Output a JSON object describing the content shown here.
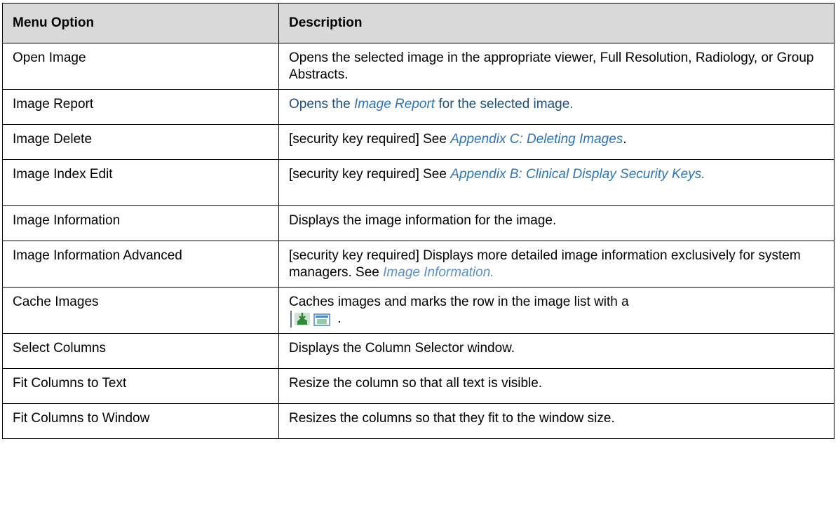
{
  "table": {
    "headers": {
      "menu_option": "Menu Option",
      "description": "Description"
    },
    "rows": [
      {
        "option": "Open Image",
        "desc": "Opens the selected image in the appropriate viewer, Full Resolution, Radiology, or Group Abstracts."
      },
      {
        "option": "Image Report",
        "desc_pre": "Opens the ",
        "desc_link": "Image Report",
        "desc_post": " for the selected image."
      },
      {
        "option": "Image Delete",
        "desc_pre": "[security key required] See ",
        "desc_link": "Appendix C: Deleting Images",
        "desc_post": "."
      },
      {
        "option": "Image Index Edit",
        "desc_pre": "[security key required] See ",
        "desc_link": "Appendix B: Clinical Display Security Keys."
      },
      {
        "option": "Image Information",
        "desc": "Displays the image information for the image."
      },
      {
        "option": "Image Information Advanced",
        "desc_pre": "[security key required] Displays more detailed image information exclusively for system managers. See ",
        "desc_link": "Image Information."
      },
      {
        "option": "Cache Images",
        "desc_pre": "Caches images and marks the row in the image list with a",
        "desc_post": " ."
      },
      {
        "option": "Select Columns",
        "desc": "Displays the Column Selector window."
      },
      {
        "option": "Fit Columns to Text",
        "desc": "Resize the column so that all text is visible."
      },
      {
        "option": "Fit Columns to Window",
        "desc": "Resizes the columns so that they fit to the window size."
      }
    ]
  },
  "icons": {
    "cache_icon": "cached-image-icon"
  },
  "colors": {
    "header_bg": "#d9d9d9",
    "link": "#2e75b6",
    "report_text": "#1f4e79"
  }
}
